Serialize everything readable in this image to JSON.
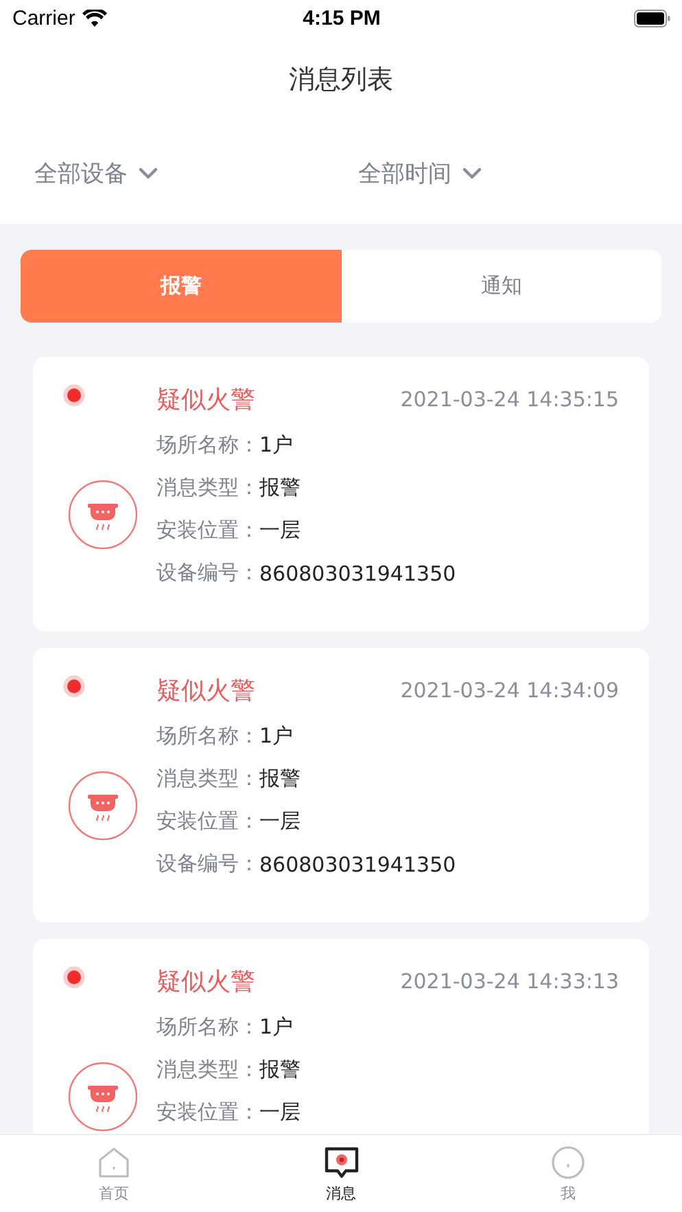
{
  "status_bar": {
    "carrier": "Carrier",
    "time": "4:15 PM"
  },
  "title": "消息列表",
  "filters": [
    {
      "label": "全部设备"
    },
    {
      "label": "全部时间"
    }
  ],
  "segments": [
    {
      "label": "报警",
      "selected": true
    },
    {
      "label": "通知",
      "selected": false
    }
  ],
  "messages": [
    {
      "title": "疑似火警",
      "time": "2021-03-24 14:35:15",
      "fields": [
        {
          "label": "场所名称：",
          "value": "1户"
        },
        {
          "label": "消息类型：",
          "value": "报警"
        },
        {
          "label": "安装位置：",
          "value": "一层"
        },
        {
          "label": "设备编号：",
          "value": "860803031941350"
        }
      ]
    },
    {
      "title": "疑似火警",
      "time": "2021-03-24 14:34:09",
      "fields": [
        {
          "label": "场所名称：",
          "value": "1户"
        },
        {
          "label": "消息类型：",
          "value": "报警"
        },
        {
          "label": "安装位置：",
          "value": "一层"
        },
        {
          "label": "设备编号：",
          "value": "860803031941350"
        }
      ]
    },
    {
      "title": "疑似火警",
      "time": "2021-03-24 14:33:13",
      "fields": [
        {
          "label": "场所名称：",
          "value": "1户"
        },
        {
          "label": "消息类型：",
          "value": "报警"
        },
        {
          "label": "安装位置：",
          "value": "一层"
        }
      ]
    }
  ],
  "tab_bar": [
    {
      "kind": "home",
      "label": "首页",
      "selected": false
    },
    {
      "kind": "message",
      "label": "消息",
      "selected": true
    },
    {
      "kind": "me",
      "label": "我",
      "selected": false
    }
  ]
}
